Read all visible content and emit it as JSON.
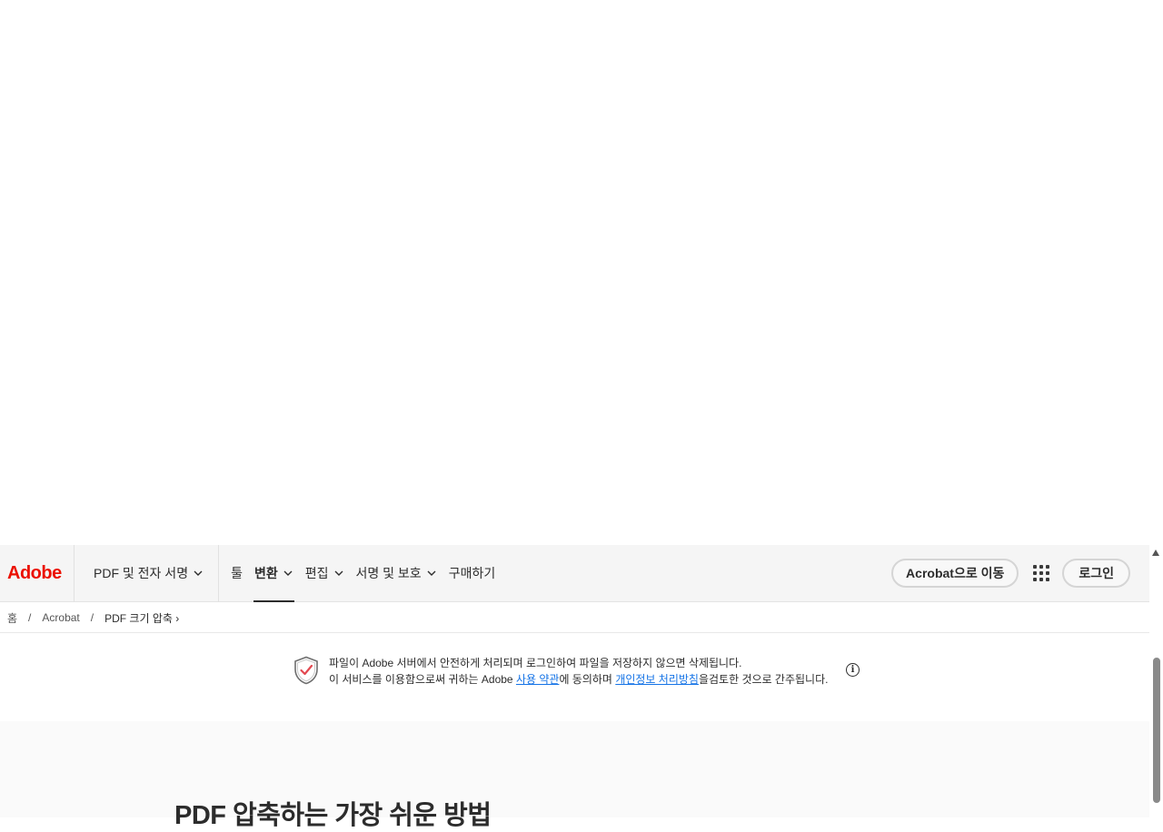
{
  "header": {
    "logo": "Adobe",
    "product_menu": "PDF 및 전자 서명",
    "menu": [
      {
        "label": "툴",
        "dropdown": false
      },
      {
        "label": "변환",
        "dropdown": true,
        "active": true
      },
      {
        "label": "편집",
        "dropdown": true
      },
      {
        "label": "서명 및 보호",
        "dropdown": true
      },
      {
        "label": "구매하기",
        "dropdown": false
      }
    ],
    "acrobat_button": "Acrobat으로 이동",
    "login_button": "로그인"
  },
  "breadcrumb": {
    "home": "홈",
    "separator": "/",
    "acrobat": "Acrobat",
    "current": "PDF 크기 압축 ›"
  },
  "notice": {
    "line1": "파일이 Adobe 서버에서 안전하게 처리되며 로그인하여 파일을 저장하지 않으면 삭제됩니다.",
    "line2_prefix": "이 서비스를 이용함으로써 귀하는 Adobe ",
    "terms_link": "사용 약관",
    "line2_mid": "에 동의하며 ",
    "privacy_link": "개인정보 처리방침",
    "line2_suffix": "을검토한 것으로 간주됩니다.",
    "info_glyph": "i"
  },
  "section": {
    "title": "PDF 압축하는 가장 쉬운 방법"
  },
  "colors": {
    "adobe_red": "#eb1000",
    "link": "#1473e6",
    "nav_bg": "#f5f5f5"
  }
}
